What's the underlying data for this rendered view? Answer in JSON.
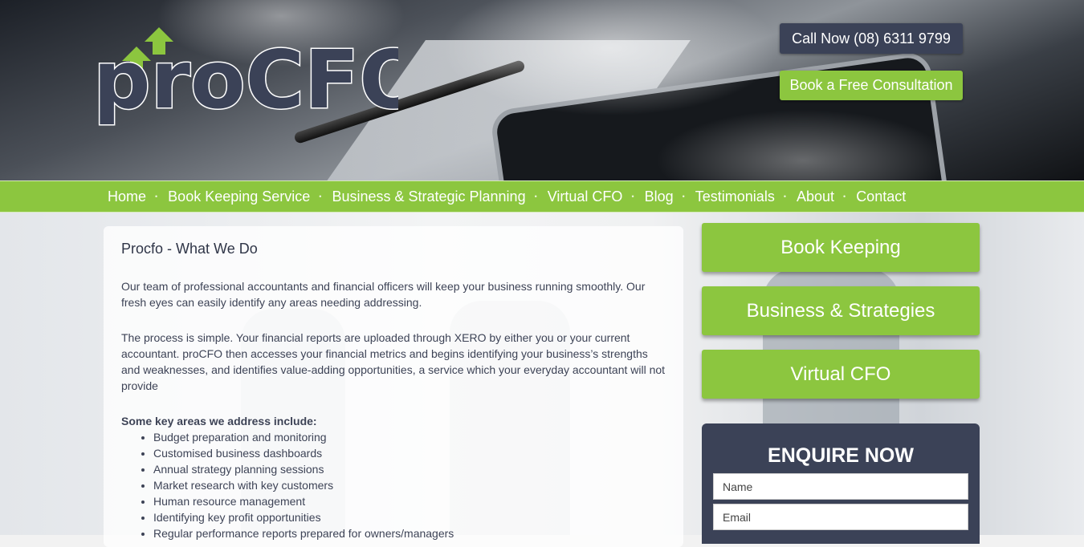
{
  "header": {
    "logo_text": "proCFO",
    "call_label": "Call Now (08) 6311 9799",
    "consult_label": "Book a Free Consultation"
  },
  "nav": {
    "items": [
      "Home",
      "Book Keeping Service",
      "Business & Strategic Planning",
      "Virtual CFO",
      "Blog",
      "Testimonials",
      "About",
      "Contact"
    ],
    "separator": "•"
  },
  "main": {
    "title": "Procfo - What We Do",
    "paragraphs": [
      "Our team of professional accountants and financial officers will keep your business running smoothly. Our fresh eyes can easily identify any areas needing addressing.",
      "The process is simple. Your financial reports are uploaded through XERO by either you or your current accountant. proCFO then accesses your financial metrics and begins identifying your business’s strengths and weaknesses, and identifies value-adding opportunities, a service which your everyday accountant will not provide"
    ],
    "areas_title": "Some key areas we address include:",
    "areas": [
      "Budget preparation and monitoring",
      "Customised business dashboards",
      "Annual strategy planning sessions",
      "Market research with key customers",
      "Human resource management",
      "Identifying key profit opportunities",
      "Regular performance reports prepared for owners/managers"
    ]
  },
  "sidebar": {
    "buttons": [
      "Book Keeping",
      "Business & Strategies",
      "Virtual CFO"
    ],
    "enquire": {
      "title": "ENQUIRE NOW",
      "name_placeholder": "Name",
      "email_placeholder": "Email"
    }
  },
  "colors": {
    "brand_green": "#8cc63f",
    "brand_navy": "#3b4257"
  }
}
